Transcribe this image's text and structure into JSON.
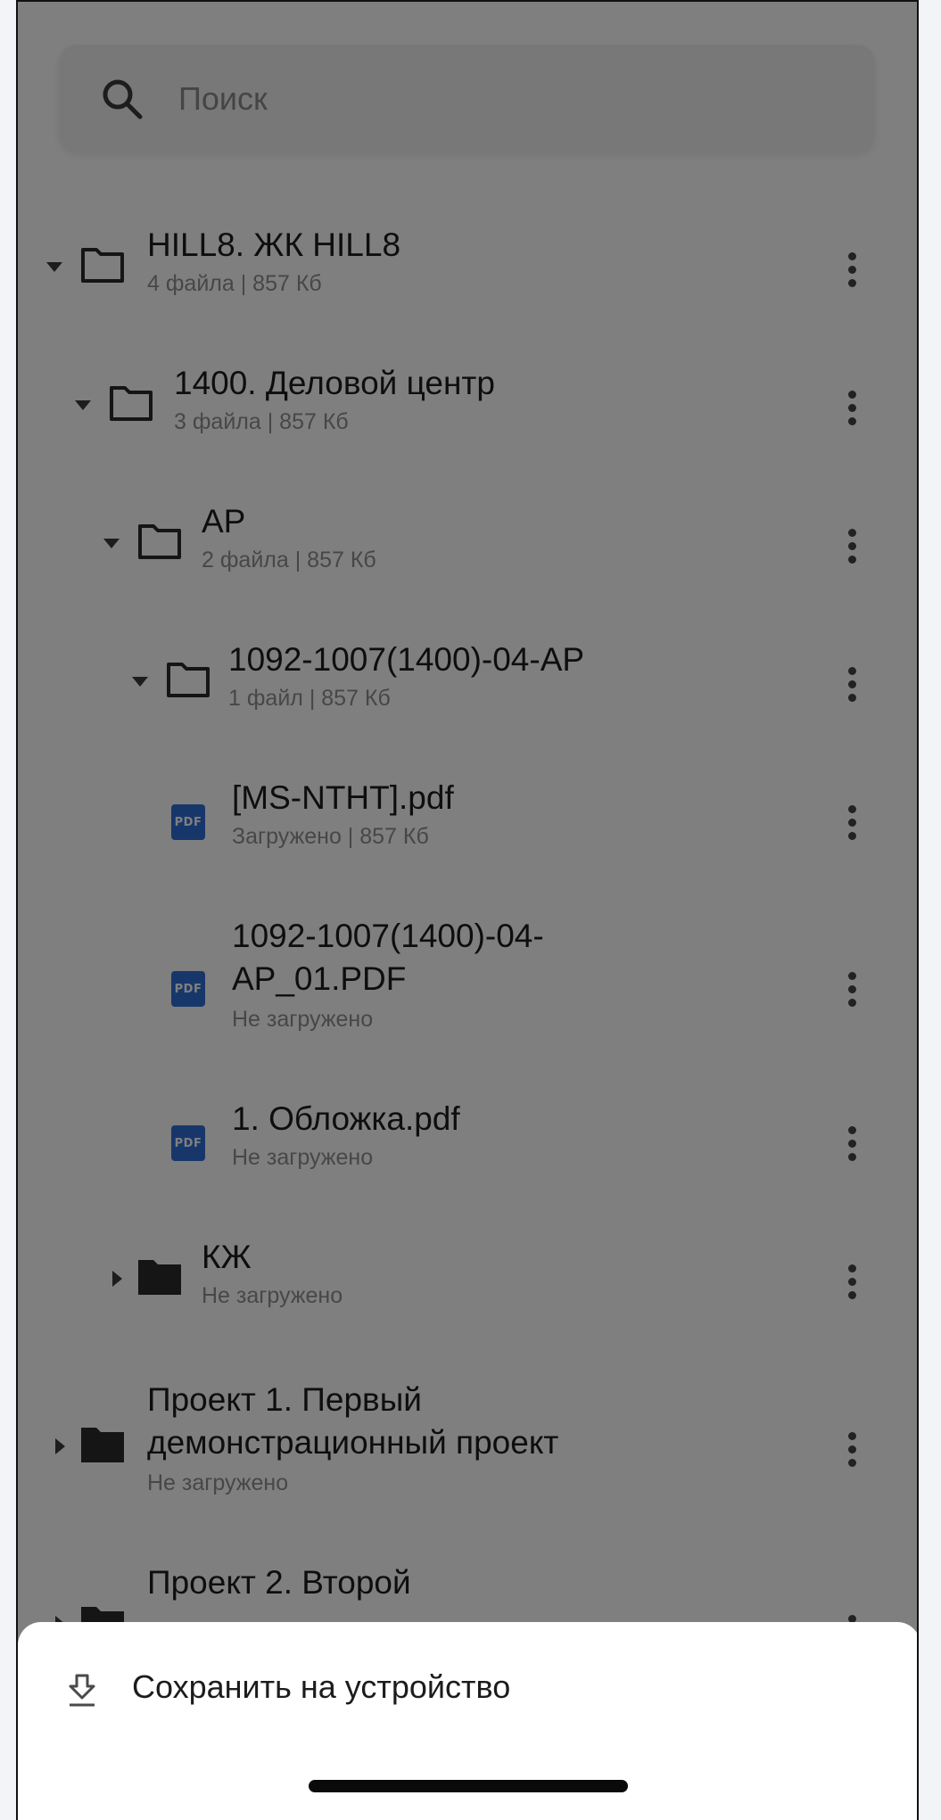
{
  "search": {
    "placeholder": "Поиск"
  },
  "tree": [
    {
      "title": "HILL8. ЖК HILL8",
      "subtitle": "4 файла | 857 Кб"
    },
    {
      "title": "1400. Деловой центр",
      "subtitle": "3 файла | 857 Кб"
    },
    {
      "title": "АР",
      "subtitle": "2 файла | 857 Кб"
    },
    {
      "title": "1092-1007(1400)-04-АР",
      "subtitle": "1 файл | 857 Кб"
    },
    {
      "title": "[MS-NTHT].pdf",
      "subtitle": "Загружено | 857 Кб",
      "badge": "PDF"
    },
    {
      "title_line1": "1092-1007(1400)-04-",
      "title_line2": "AP_01.PDF",
      "subtitle": "Не загружено",
      "badge": "PDF"
    },
    {
      "title": "1. Обложка.pdf",
      "subtitle": "Не загружено",
      "badge": "PDF"
    },
    {
      "title": "КЖ",
      "subtitle": "Не загружено"
    },
    {
      "title_line1": "Проект 1. Первый",
      "title_line2": "демонстрационный проект",
      "subtitle": "Не загружено"
    },
    {
      "title": "Проект 2. Второй"
    }
  ],
  "sheet": {
    "download_label": "Сохранить на устройство"
  },
  "icons": {
    "search": "search-icon",
    "folder_open": "folder-outline-icon",
    "folder_closed": "folder-filled-icon",
    "pdf": "pdf-file-icon",
    "more": "more-vertical-icon",
    "download": "download-icon"
  }
}
